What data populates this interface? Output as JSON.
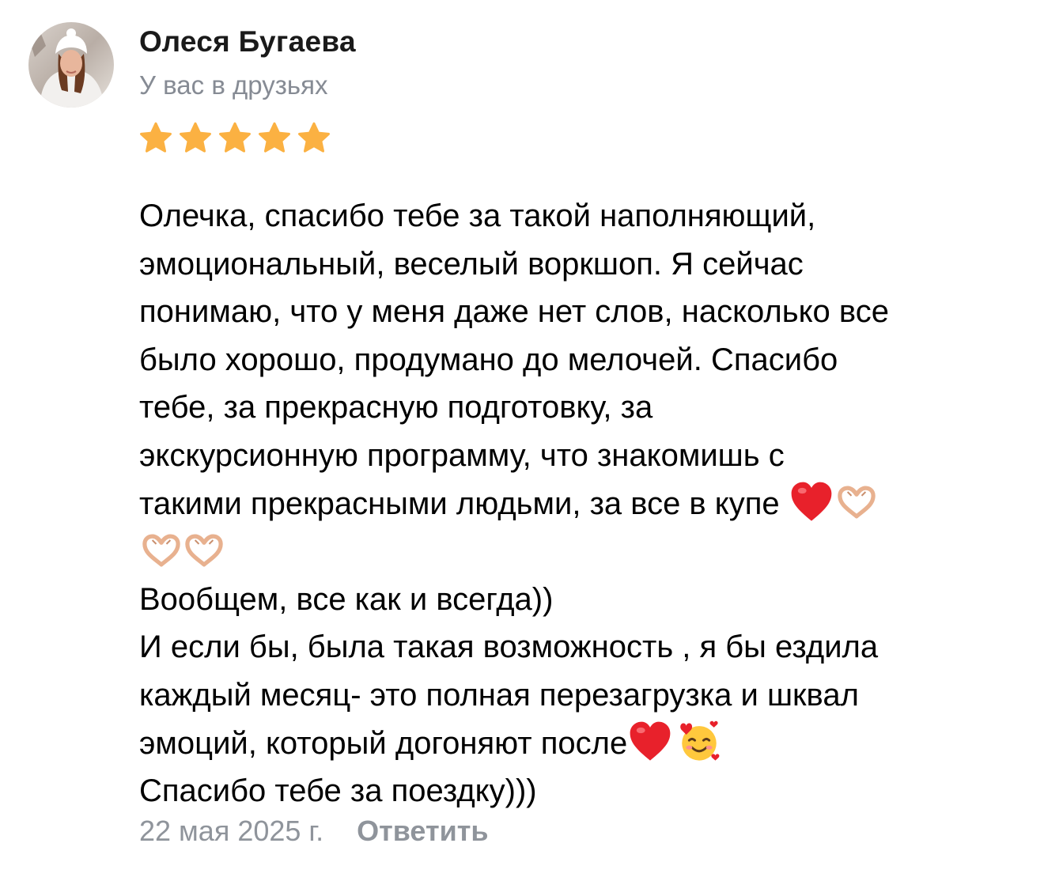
{
  "review": {
    "author": {
      "name": "Олеся Бугаева",
      "relation": "У вас в друзьях",
      "avatar_icon": "user-photo-avatar"
    },
    "rating": {
      "value": 5,
      "max": 5,
      "star_color": "#fbb142"
    },
    "text_lines": [
      "Олечка, спасибо тебе за такой наполняющий,",
      "эмоциональный, веселый воркшоп. Я сейчас",
      "понимаю, что у меня даже нет слов, насколько все",
      "было хорошо, продумано до мелочей. Спасибо",
      "тебе, за прекрасную подготовку, за",
      "экскурсионную программу, что знакомишь с",
      "такими прекрасными людьми, за все в купе ",
      "",
      "Вообщем, все как и всегда))",
      "И если бы, была такая возможность , я бы ездила",
      "каждый месяц- это полная перезагрузка и шквал",
      "эмоций, который догоняют после",
      "Спасибо тебе за поездку)))"
    ],
    "emoji_icons": {
      "heart": "red-heart-emoji",
      "heart_hands": "heart-hands-emoji",
      "smile_hearts": "smiling-face-with-hearts-emoji"
    },
    "date": "22 мая 2025 г.",
    "reply_label": "Ответить",
    "colors": {
      "secondary_text": "#868b94",
      "heart_red": "#e8212b"
    }
  }
}
